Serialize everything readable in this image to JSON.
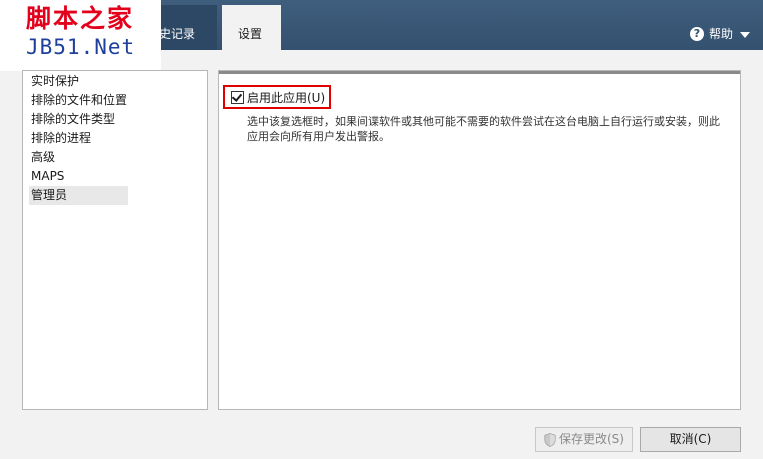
{
  "watermark": {
    "line1": "脚本之家",
    "line2": "JB51.Net"
  },
  "tabs": [
    {
      "label": "历史记录",
      "visible_label": "史记录",
      "selected": false
    },
    {
      "label": "设置",
      "selected": true
    }
  ],
  "help": {
    "label": "帮助",
    "icon": "question-circle-icon"
  },
  "sidebar": {
    "items": [
      {
        "label": "实时保护",
        "selected": false
      },
      {
        "label": "排除的文件和位置",
        "selected": false
      },
      {
        "label": "排除的文件类型",
        "selected": false
      },
      {
        "label": "排除的进程",
        "selected": false
      },
      {
        "label": "高级",
        "selected": false
      },
      {
        "label": "MAPS",
        "selected": false
      },
      {
        "label": "管理员",
        "selected": true
      }
    ]
  },
  "settings": {
    "enable_app": {
      "label": "启用此应用(U)",
      "checked": true,
      "description": "选中该复选框时，如果间谍软件或其他可能不需要的软件尝试在这台电脑上自行运行或安装，则此应用会向所有用户发出警报。"
    }
  },
  "footer": {
    "save_label": "保存更改(S)",
    "save_enabled": false,
    "cancel_label": "取消(C)"
  },
  "colors": {
    "header": "#3a5877",
    "highlight_border": "#e00000",
    "watermark_red": "#e3001b",
    "watermark_blue": "#1e3f9c"
  }
}
